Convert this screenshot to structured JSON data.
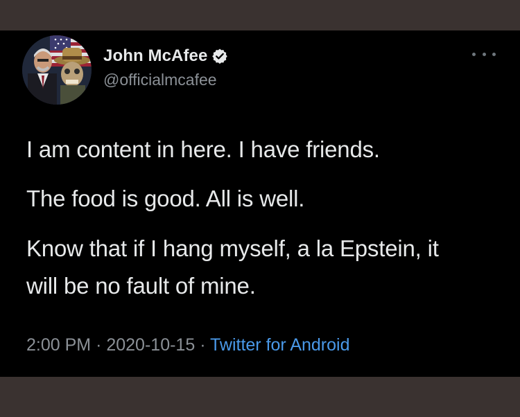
{
  "tweet": {
    "author": {
      "display_name": "John McAfee",
      "handle": "@officialmcafee",
      "verified": true
    },
    "text_lines": [
      "I am content in here. I have friends.",
      "The food is good. All is well.",
      "Know that if I hang myself, a la Epstein, it",
      "will be no fault of mine."
    ],
    "time": "2:00 PM",
    "separator": "·",
    "date": "2020-10-15",
    "source": "Twitter for Android"
  },
  "icons": {
    "verified": "verified-badge-icon",
    "more": "more-options-icon",
    "avatar": "profile-photo"
  },
  "colors": {
    "background": "#000000",
    "frame": "#3a3230",
    "text_primary": "#e7e9ea",
    "text_secondary": "#8b9096",
    "link": "#4a99e9"
  }
}
